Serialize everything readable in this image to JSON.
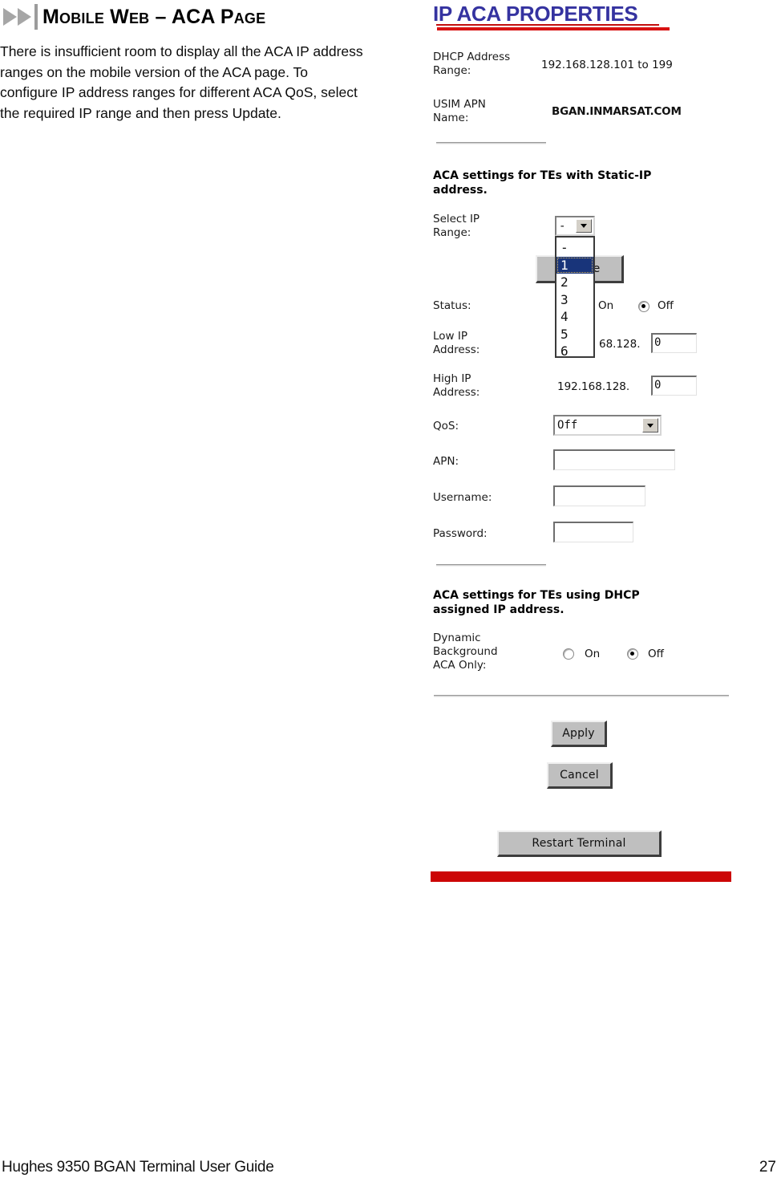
{
  "document": {
    "heading": "Mobile Web – ACA Page",
    "bullet_icon": "double-triangle-icon",
    "body_text": "There is insufficient room to display all the ACA IP address ranges on the mobile version of the ACA page. To configure IP address ranges for different ACA QoS, select the required IP range and then press Update.",
    "footer_title": "Hughes 9350 BGAN Terminal User Guide",
    "page_number": "27"
  },
  "colors": {
    "title_blue": "#3533a0",
    "rule_red": "#cc0606",
    "selection_blue": "#18347a",
    "button_face": "#bfbfbf"
  },
  "screenshot": {
    "title": "IP ACA PROPERTIES",
    "info": {
      "dhcp_label": "DHCP Address\nRange:",
      "dhcp_value": "192.168.128.101 to 199",
      "apn_label": "USIM APN\nName:",
      "apn_value": "BGAN.INMARSAT.COM"
    },
    "static_section": {
      "heading": "ACA settings for TEs with Static-IP\naddress.",
      "select_ip_label": "Select IP\nRange:",
      "select_ip_value": "-",
      "dropdown_open": true,
      "dropdown_options": [
        "-",
        "1",
        "2",
        "3",
        "4",
        "5",
        "6"
      ],
      "dropdown_selected": "1",
      "update_button": "Update",
      "status_label": "Status:",
      "status_on": "On",
      "status_off": "Off",
      "status_value": "Off",
      "low_ip_label": "Low IP\nAddress:",
      "low_ip_prefix": "192.168.128.",
      "low_ip_prefix_visible": "68.128.",
      "low_ip_value": "0",
      "high_ip_label": "High IP\nAddress:",
      "high_ip_prefix": "192.168.128.",
      "high_ip_value": "0",
      "qos_label": "QoS:",
      "qos_value": "Off",
      "apn_label": "APN:",
      "apn_value": "",
      "username_label": "Username:",
      "username_value": "",
      "password_label": "Password:",
      "password_value": ""
    },
    "dhcp_section": {
      "heading": "ACA settings for TEs using DHCP\nassigned IP address.",
      "dynamic_label": "Dynamic\nBackground\nACA Only:",
      "on_label": "On",
      "off_label": "Off",
      "value": "Off"
    },
    "buttons": {
      "apply": "Apply",
      "cancel": "Cancel",
      "restart": "Restart Terminal"
    }
  }
}
